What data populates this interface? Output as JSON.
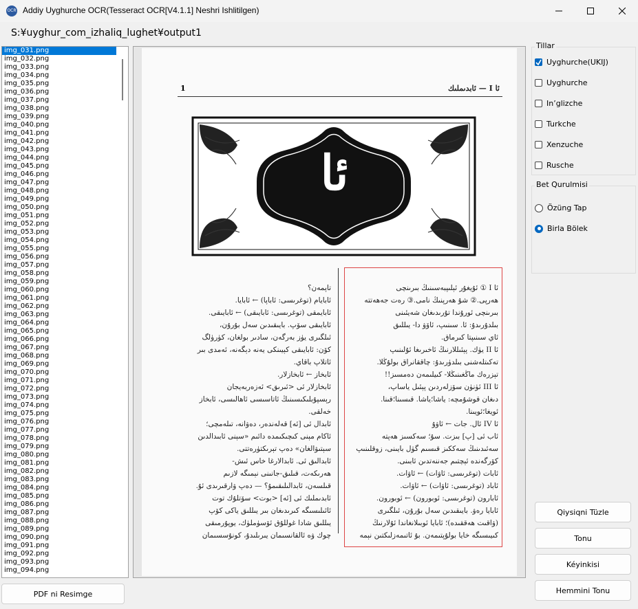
{
  "window": {
    "title": "Addiy Uyghurche OCR(Tesseract OCR[V4.1.1] Neshri Ishlitilgen)",
    "icon_label": "OCR",
    "minimize_icon": "minimize-icon",
    "maximize_icon": "maximize-icon",
    "close_icon": "close-icon"
  },
  "path": "S:¥uyghur_com_izhaliq_lughet¥output1",
  "file_list": {
    "selected_index": 0,
    "items": [
      "img_031.png",
      "img_032.png",
      "img_033.png",
      "img_034.png",
      "img_035.png",
      "img_036.png",
      "img_037.png",
      "img_038.png",
      "img_039.png",
      "img_040.png",
      "img_041.png",
      "img_042.png",
      "img_043.png",
      "img_044.png",
      "img_045.png",
      "img_046.png",
      "img_047.png",
      "img_048.png",
      "img_049.png",
      "img_050.png",
      "img_051.png",
      "img_052.png",
      "img_053.png",
      "img_054.png",
      "img_055.png",
      "img_056.png",
      "img_057.png",
      "img_058.png",
      "img_059.png",
      "img_060.png",
      "img_061.png",
      "img_062.png",
      "img_063.png",
      "img_064.png",
      "img_065.png",
      "img_066.png",
      "img_067.png",
      "img_068.png",
      "img_069.png",
      "img_070.png",
      "img_071.png",
      "img_072.png",
      "img_073.png",
      "img_074.png",
      "img_075.png",
      "img_076.png",
      "img_077.png",
      "img_078.png",
      "img_079.png",
      "img_080.png",
      "img_081.png",
      "img_082.png",
      "img_083.png",
      "img_084.png",
      "img_085.png",
      "img_086.png",
      "img_087.png",
      "img_088.png",
      "img_089.png",
      "img_090.png",
      "img_091.png",
      "img_092.png",
      "img_093.png",
      "img_094.png"
    ]
  },
  "pdf_button": "PDF ni Resimge",
  "page": {
    "page_number": "1",
    "header": "ئا I — ئابدىملىك",
    "big_letter": "ئا",
    "left_col": [
      "تاپمەن؟",
      "ئابايام (توغرىسى: ئاباپا) ← ئابايا.",
      "ئابايمقى (توغرىسى: ئابايىقى) ← ئابايىقى.",
      "ئابايىقى سۆپ. بايىقىدىن سەل بۇرۇن،",
      "ئىلگىرى يۈز بەرگەن، سادىر بولغان، كۈرۈلگ",
      "كۆن: ئابايىقى كېيىنكى يەنە دېگەنە، ئەمدى بىر",
      "ئاتلاپ باقاي.",
      "ئابخاز ← ئابخازلار.",
      "ئابخازلار ئى <ئىرىق> ئەزەربەيجان",
      "رېسپۇبلىكىسىنىڭ ئاتاسىسى ئاھالىسى، ئابخاز",
      "خەلقى.",
      "ئابدال ئى [ئە] قەلەندەر، دەۋانە، تىلەمچى؛",
      "ئاكام مېنى كىچىكىمدە دائىم «سېنى ئابىدالدىن",
      "سېتىۋالغان» دەپ تېرىكتۈرەتتى.",
      "ئابدالىق ئى. ئابدالارغا خاس ئىش-",
      "ھەرىكەت، قىلىق-جانىنى نېمىگە لازىم",
      "قىلسەن، ئابدالىلىقىمۇ؟ — دەپ ۋارقىرىدى ئۇ.",
      "ئابدىملىك ئى [ئە] <بوت> سۆتلۇك توت",
      "ئائىلىسىگە كىرىدىغان بىر يىللىق ياكى كۆپ",
      "يىللىق شادا غوللۇق ئۆسۈملۈك، يوپۇرمىقى",
      "چوك ۋە ئالقانسىمان يىرىلىدۇ، كونۇسسىمان"
    ],
    "right_col": [
      "ئا I ① ئۇيغۇر ئېلىپبەسىنىڭ بىرىنچى",
      "ھەرپى.② شۇ ھەرپنىڭ نامى.③ رەت جەھەتتە",
      "بىرىنچى ئورۇندا تۇرىدىغان شەيئىنى",
      "بىلدۇرىدۇ: ئا. سىنىپ، ئاۆۋ دا- يىللىق",
      "ئاي سىنىپتا كىرماق.",
      "ئا II يۈك. پېئىللارنىڭ ئاخىرىغا ئۇلىنىپ",
      "تەكىتلەشنى بىلدۈرىدۇ: چاققانراق بولۇڭلا.",
      "تېزرەك ماڭغىنىڭلا- كىيلىمەن دەمسىز!!",
      "ئا III ئۈنۈن سۆزلەردىن پېئىل ياساپ،",
      "دىغان قوشۇمچە: ياشا؛ياشا. قىسىنا؛قىنا.",
      "ئويغا؛ئويىنا.",
      "ئا IV ئال. جات ← ئاۋۇ",
      "ئاب ئى [پ] بىزت. سۇ؛ سەكسىز ھەپتە",
      "سەئىدىنىڭ سەككىز قىسىم گۈل بايىنى، زوقلىنىپ",
      "كۆرگەندە ئېچتىم جەننەتدىن ئابىنى.",
      "ئابات (توغرىسى: ئاۋات) ← ئاۋات.",
      "ئاباد (توغرىسى: ئاۋات) ← ئاۋات.",
      "ئابارون (توغرىسى: ئوبورون) ← ئوبورون.",
      "ئابايا رەۋ. بايىقىدىن سەل بۇرۇن، ئىلگىرى",
      "(ۋاقىت ھەققىدە)؛ ئابايا ئوبىلانغاندا ئۇلارنىڭ",
      "كىيىسىگە خايا بولۇپتىمەن. بۇ ئاتىمەزلىكتىن نېمە"
    ]
  },
  "languages": {
    "title": "Tillar",
    "options": [
      {
        "label": "Uyghurche(UKIJ)",
        "checked": true
      },
      {
        "label": "Uyghurche",
        "checked": false
      },
      {
        "label": "In’glizche",
        "checked": false
      },
      {
        "label": "Turkche",
        "checked": false
      },
      {
        "label": "Xenzuche",
        "checked": false
      },
      {
        "label": "Rusche",
        "checked": false
      }
    ]
  },
  "page_layout": {
    "title": "Bet Qurulmisi",
    "options": [
      {
        "label": "Özüng Tap",
        "selected": false
      },
      {
        "label": "Birla Bölek",
        "selected": true
      }
    ]
  },
  "buttons": {
    "fix_spelling": "Qiysiqni Tüzle",
    "recognize": "Tonu",
    "next": "Kéyinkisi",
    "recognize_all": "Hemmini Tonu"
  }
}
